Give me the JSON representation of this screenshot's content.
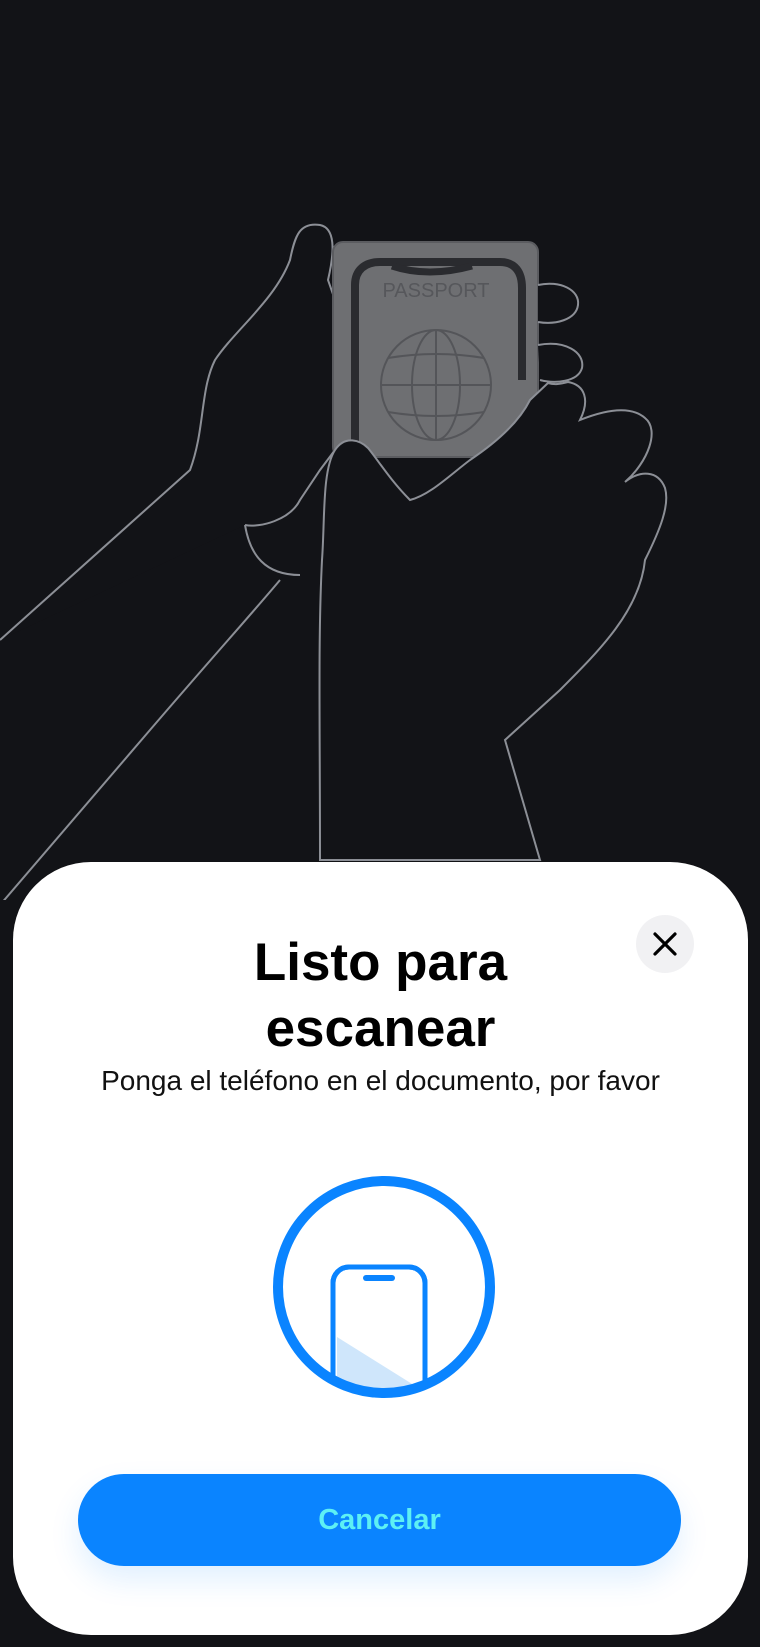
{
  "illustration": {
    "document_label": "PASSPORT",
    "hands_icon": "hands-holding-passport-and-phone-icon",
    "globe_icon": "globe-icon"
  },
  "sheet": {
    "title_line1": "Listo para",
    "title_line2": "escanear",
    "subtitle": "Ponga el teléfono en el documento, por favor",
    "close_icon": "close-icon",
    "scan_icon": "phone-scan-icon",
    "cancel_label": "Cancelar"
  },
  "colors": {
    "background": "#121317",
    "sheet": "#ffffff",
    "accent": "#0a84ff",
    "cancel_text": "#5df0f4",
    "close_bg": "#f1f1f3"
  }
}
